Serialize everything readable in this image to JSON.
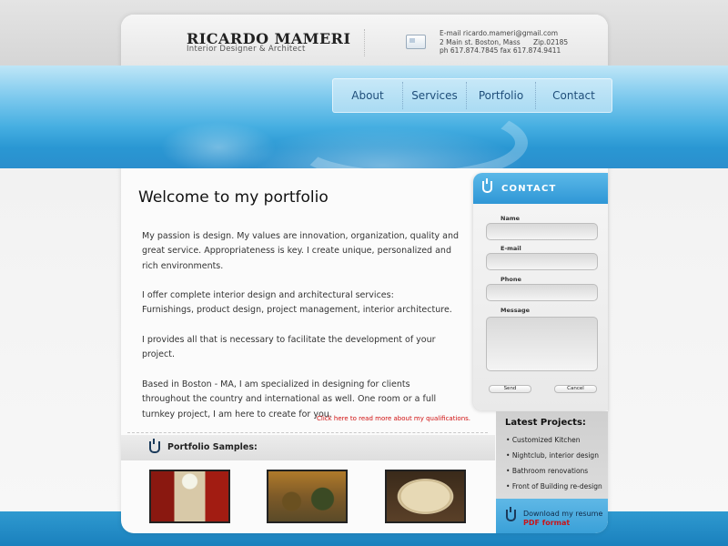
{
  "header": {
    "name": "RICARDO MAMERI",
    "subtitle": "Interior Designer & Architect",
    "contact": {
      "email": "E-mail ricardo.mameri@gmail.com",
      "address": "2 Main st. Boston, Mass      Zip.02185",
      "phone": "ph  617.874.7845 fax 617.874.9411"
    }
  },
  "nav": {
    "items": [
      {
        "label": "About"
      },
      {
        "label": "Services"
      },
      {
        "label": "Portfolio"
      },
      {
        "label": "Contact"
      }
    ]
  },
  "main": {
    "title": "Welcome to my portfolio",
    "paragraphs": [
      "My passion is design. My values are innovation, organization, quality and great service. Appropriateness is key. I create unique, personalized and rich environments.",
      "I offer complete interior design and architectural services:\nFurnishings, product design, project management, interior architecture.",
      "I provides all that is necessary to facilitate the development of your project.",
      "Based in Boston - MA, I am specialized in designing for clients throughout the country and international as well. One room or a full turnkey project, I am here to create for you."
    ],
    "read_more": "Click here to read more about my qualifications."
  },
  "portfolio": {
    "title": "Portfolio Samples:"
  },
  "contact_form": {
    "title": "CONTACT",
    "labels": {
      "name": "Name",
      "email": "E-mail",
      "phone": "Phone",
      "message": "Message"
    },
    "values": {
      "name": "",
      "email": "",
      "phone": "",
      "message": ""
    },
    "send": "Send",
    "cancel": "Cancel"
  },
  "latest_projects": {
    "title": "Latest Projects:",
    "items": [
      "Customized Kitchen",
      "Nightclub, interior design",
      "Bathroom renovations",
      "Front of Building re-design"
    ]
  },
  "resume": {
    "line1": "Download my resume",
    "line2": "PDF format"
  },
  "colors": {
    "accent_blue": "#2f97d6",
    "link_red": "#d01010",
    "nav_text": "#1f4e7a"
  }
}
